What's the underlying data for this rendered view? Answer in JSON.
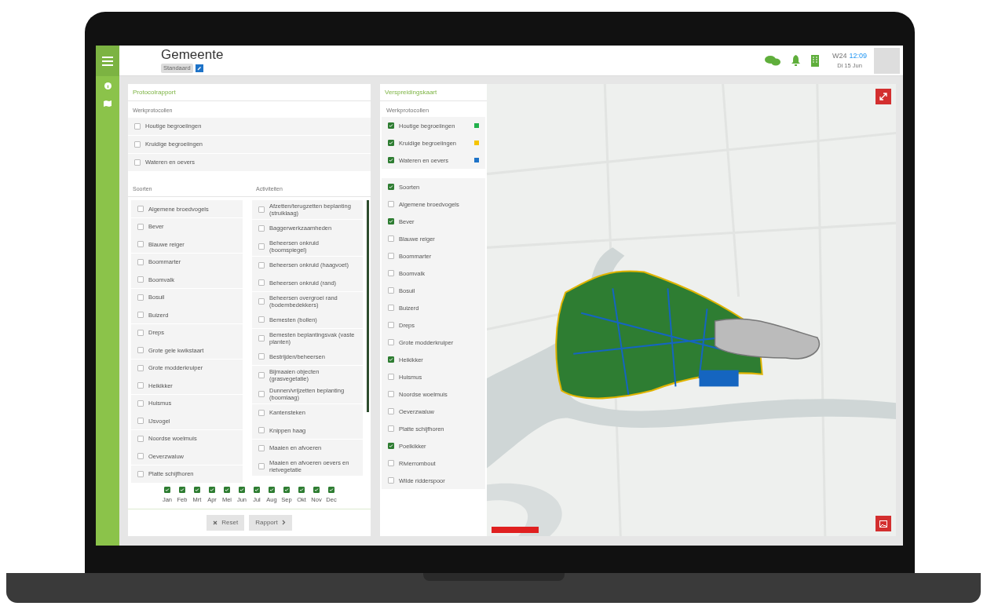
{
  "header": {
    "title": "Gemeente",
    "badge": "Standaard",
    "week": "W24",
    "time": "12:09",
    "date": "Di 15 Jun"
  },
  "report": {
    "title": "Protocolrapport",
    "protocols_label": "Werkprotocollen",
    "protocols": [
      {
        "label": "Houtige begroeiingen",
        "checked": false
      },
      {
        "label": "Kruidige begroeiingen",
        "checked": false
      },
      {
        "label": "Wateren en oevers",
        "checked": false
      }
    ],
    "species_label": "Soorten",
    "activities_label": "Activiteiten",
    "species": [
      {
        "label": "Algemene broedvogels",
        "checked": false
      },
      {
        "label": "Bever",
        "checked": false
      },
      {
        "label": "Blauwe reiger",
        "checked": false
      },
      {
        "label": "Boommarter",
        "checked": false
      },
      {
        "label": "Boomvalk",
        "checked": false
      },
      {
        "label": "Bosuil",
        "checked": false
      },
      {
        "label": "Buizerd",
        "checked": false
      },
      {
        "label": "Dreps",
        "checked": false
      },
      {
        "label": "Grote gele kwikstaart",
        "checked": false
      },
      {
        "label": "Grote modderkruiper",
        "checked": false
      },
      {
        "label": "Heikikker",
        "checked": false
      },
      {
        "label": "Huismus",
        "checked": false
      },
      {
        "label": "IJsvogel",
        "checked": false
      },
      {
        "label": "Noordse woelmuis",
        "checked": false
      },
      {
        "label": "Oeverzwaluw",
        "checked": false
      },
      {
        "label": "Platte schijfhoren",
        "checked": false
      }
    ],
    "activities": [
      {
        "label": "Afzetten/terugzetten beplanting (struiklaag)",
        "checked": false
      },
      {
        "label": "Baggerwerkzaamheden",
        "checked": false
      },
      {
        "label": "Beheersen onkruid (boomspiegel)",
        "checked": false
      },
      {
        "label": "Beheersen onkruid (haagvoet)",
        "checked": false
      },
      {
        "label": "Beheersen onkruid (rand)",
        "checked": false
      },
      {
        "label": "Beheersen overgroei rand (bodembedekkers)",
        "checked": false
      },
      {
        "label": "Bemesten (bollen)",
        "checked": false
      },
      {
        "label": "Bemesten beplantingsvak (vaste planten)",
        "checked": false
      },
      {
        "label": "Bestrijden/beheersen",
        "checked": false
      },
      {
        "label": "Bijmaaien objecten (grasvegetatie)",
        "checked": false
      },
      {
        "label": "Dunnen/vrijzetten beplanting (boomlaag)",
        "checked": false
      },
      {
        "label": "Kantensteken",
        "checked": false
      },
      {
        "label": "Knippen haag",
        "checked": false
      },
      {
        "label": "Maaien en afvoeren",
        "checked": false
      },
      {
        "label": "Maaien en afvoeren oevers en rietvegetatie",
        "checked": false
      }
    ],
    "months": [
      {
        "label": "Jan",
        "checked": true
      },
      {
        "label": "Feb",
        "checked": true
      },
      {
        "label": "Mrt",
        "checked": true
      },
      {
        "label": "Apr",
        "checked": true
      },
      {
        "label": "Mei",
        "checked": true
      },
      {
        "label": "Jun",
        "checked": true
      },
      {
        "label": "Jul",
        "checked": true
      },
      {
        "label": "Aug",
        "checked": true
      },
      {
        "label": "Sep",
        "checked": true
      },
      {
        "label": "Okt",
        "checked": true
      },
      {
        "label": "Nov",
        "checked": true
      },
      {
        "label": "Dec",
        "checked": true
      }
    ],
    "buttons": [
      {
        "label": "Reset",
        "disabled": true
      },
      {
        "label": "Rapport",
        "disabled": true
      }
    ]
  },
  "map_panel": {
    "title": "Verspreidingskaart",
    "protocols_label": "Werkprotocollen",
    "protocols": [
      {
        "label": "Houtige begroeiingen",
        "checked": true,
        "color": "#22b04b"
      },
      {
        "label": "Kruidige begroeiingen",
        "checked": true,
        "color": "#f5c400"
      },
      {
        "label": "Wateren en oevers",
        "checked": true,
        "color": "#1e73c8"
      }
    ],
    "species_toggle": {
      "label": "Soorten",
      "checked": true
    },
    "species": [
      {
        "label": "Algemene broedvogels",
        "checked": false
      },
      {
        "label": "Bever",
        "checked": true
      },
      {
        "label": "Blauwe reiger",
        "checked": false
      },
      {
        "label": "Boommarter",
        "checked": false
      },
      {
        "label": "Boomvalk",
        "checked": false
      },
      {
        "label": "Bosuil",
        "checked": false
      },
      {
        "label": "Buizerd",
        "checked": false
      },
      {
        "label": "Dreps",
        "checked": false
      },
      {
        "label": "Grote modderkruiper",
        "checked": false
      },
      {
        "label": "Heikikker",
        "checked": true
      },
      {
        "label": "Huismus",
        "checked": false
      },
      {
        "label": "Noordse woelmuis",
        "checked": false
      },
      {
        "label": "Oeverzwaluw",
        "checked": false
      },
      {
        "label": "Platte schijfhoren",
        "checked": false
      },
      {
        "label": "Poelkikker",
        "checked": true
      },
      {
        "label": "Rivierrombout",
        "checked": false
      },
      {
        "label": "Wilde ridderspoor",
        "checked": false
      }
    ]
  }
}
